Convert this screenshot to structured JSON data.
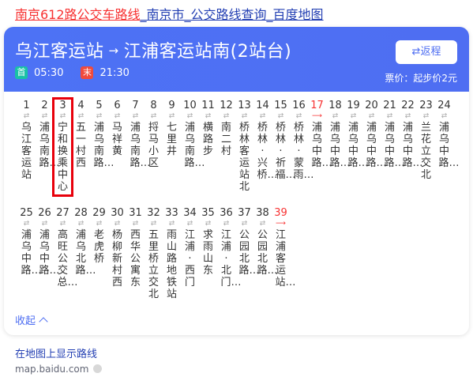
{
  "result": {
    "title_highlight": "南京612路公交车路线",
    "title_rest": "_南京市_公交路线查询_百度地图"
  },
  "header": {
    "route_from": "乌江客运站",
    "route_arrow": "→",
    "route_to": "江浦客运站南(2站台)",
    "first_badge": "首",
    "first_time": "05:30",
    "last_badge": "末",
    "last_time": "21:30",
    "return_label": "⇄返程",
    "fare": "票价：起步价2元"
  },
  "stations": [
    {
      "num": "1",
      "name": "乌江客运站"
    },
    {
      "num": "2",
      "name": "浦乌南路…"
    },
    {
      "num": "3",
      "name": "宁和换乘中心",
      "highlight": true
    },
    {
      "num": "4",
      "name": "五一村西"
    },
    {
      "num": "5",
      "name": "浦乌南路…"
    },
    {
      "num": "6",
      "name": "马祥黄"
    },
    {
      "num": "7",
      "name": "浦乌南路…"
    },
    {
      "num": "8",
      "name": "捋马小区"
    },
    {
      "num": "9",
      "name": "七里井"
    },
    {
      "num": "10",
      "name": "浦乌南路…"
    },
    {
      "num": "11",
      "name": "横路步"
    },
    {
      "num": "12",
      "name": "南二村"
    },
    {
      "num": "13",
      "name": "桥林客运站北"
    },
    {
      "num": "14",
      "name": "桥林·兴桥…"
    },
    {
      "num": "15",
      "name": "桥林·祈福…"
    },
    {
      "num": "16",
      "name": "桥林·蒙雨…"
    },
    {
      "num": "17",
      "name": "浦乌中路…",
      "red": true
    },
    {
      "num": "18",
      "name": "浦乌中路…"
    },
    {
      "num": "19",
      "name": "浦乌中路…"
    },
    {
      "num": "20",
      "name": "浦乌中路…"
    },
    {
      "num": "21",
      "name": "浦乌中路…"
    },
    {
      "num": "22",
      "name": "浦乌中路…"
    },
    {
      "num": "23",
      "name": "兰花立交北"
    },
    {
      "num": "24",
      "name": "浦乌中路…"
    },
    {
      "num": "25",
      "name": "浦乌中路…"
    },
    {
      "num": "26",
      "name": "浦乌中路…"
    },
    {
      "num": "27",
      "name": "高旺公交总…"
    },
    {
      "num": "28",
      "name": "浦乌北路…"
    },
    {
      "num": "29",
      "name": "老虎桥"
    },
    {
      "num": "30",
      "name": "杨柳新村西"
    },
    {
      "num": "31",
      "name": "西华公寓东"
    },
    {
      "num": "32",
      "name": "五里桥立交北"
    },
    {
      "num": "33",
      "name": "雨山路地铁站"
    },
    {
      "num": "34",
      "name": "江浦·西门"
    },
    {
      "num": "35",
      "name": "求雨山东"
    },
    {
      "num": "36",
      "name": "江浦·北门…"
    },
    {
      "num": "37",
      "name": "公园北路…"
    },
    {
      "num": "38",
      "name": "公园北路…"
    },
    {
      "num": "39",
      "name": "江浦客运站…",
      "red": true
    }
  ],
  "arrow_glyph": "⇄",
  "arrow_glyph_terminal": "⟶",
  "collapse_label": "收起",
  "map_link": "在地图上显示路线",
  "source": "map.baidu.com",
  "colors": {
    "accent": "#4e6ef2",
    "red": "#f73131",
    "link": "#2440b3"
  }
}
